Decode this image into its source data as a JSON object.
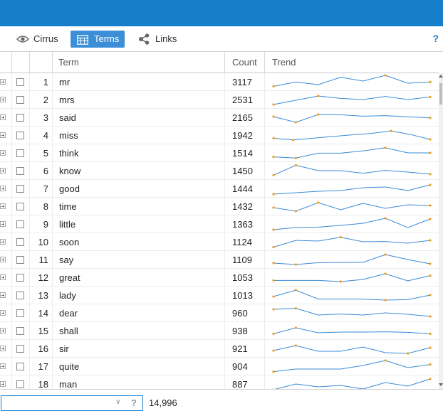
{
  "tabs": [
    {
      "label": "Cirrus",
      "icon": "eye-icon",
      "active": false
    },
    {
      "label": "Terms",
      "icon": "table-icon",
      "active": true
    },
    {
      "label": "Links",
      "icon": "share-icon",
      "active": false
    }
  ],
  "help_label": "?",
  "columns": {
    "term": "Term",
    "count": "Count",
    "trend": "Trend"
  },
  "rows": [
    {
      "num": "1",
      "term": "mr",
      "count": "3117",
      "trend": [
        0.18,
        0.48,
        0.3,
        0.82,
        0.55,
        0.95,
        0.4,
        0.48
      ]
    },
    {
      "num": "2",
      "term": "mrs",
      "count": "2531",
      "trend": [
        0.15,
        0.45,
        0.75,
        0.58,
        0.5,
        0.72,
        0.5,
        0.68
      ]
    },
    {
      "num": "3",
      "term": "said",
      "count": "2165",
      "trend": [
        0.55,
        0.15,
        0.7,
        0.68,
        0.58,
        0.62,
        0.54,
        0.47
      ]
    },
    {
      "num": "4",
      "term": "miss",
      "count": "1942",
      "trend": [
        0.28,
        0.16,
        0.28,
        0.4,
        0.52,
        0.62,
        0.8,
        0.54,
        0.2
      ]
    },
    {
      "num": "5",
      "term": "think",
      "count": "1514",
      "trend": [
        0.22,
        0.14,
        0.48,
        0.48,
        0.64,
        0.86,
        0.5,
        0.5
      ]
    },
    {
      "num": "6",
      "term": "know",
      "count": "1450",
      "trend": [
        0.18,
        0.88,
        0.5,
        0.5,
        0.32,
        0.52,
        0.4,
        0.26
      ]
    },
    {
      "num": "7",
      "term": "good",
      "count": "1444",
      "trend": [
        0.1,
        0.2,
        0.3,
        0.35,
        0.55,
        0.6,
        0.35,
        0.75
      ]
    },
    {
      "num": "8",
      "term": "time",
      "count": "1432",
      "trend": [
        0.4,
        0.15,
        0.75,
        0.25,
        0.7,
        0.35,
        0.6,
        0.55
      ]
    },
    {
      "num": "9",
      "term": "little",
      "count": "1363",
      "trend": [
        0.1,
        0.25,
        0.28,
        0.4,
        0.55,
        0.9,
        0.25,
        0.85
      ]
    },
    {
      "num": "10",
      "term": "soon",
      "count": "1124",
      "trend": [
        0.12,
        0.6,
        0.55,
        0.82,
        0.5,
        0.52,
        0.4,
        0.6
      ]
    },
    {
      "num": "11",
      "term": "say",
      "count": "1109",
      "trend": [
        0.25,
        0.15,
        0.28,
        0.3,
        0.3,
        0.85,
        0.5,
        0.2
      ]
    },
    {
      "num": "12",
      "term": "great",
      "count": "1053",
      "trend": [
        0.28,
        0.28,
        0.28,
        0.2,
        0.35,
        0.75,
        0.25,
        0.62
      ]
    },
    {
      "num": "13",
      "term": "lady",
      "count": "1013",
      "trend": [
        0.4,
        0.85,
        0.22,
        0.22,
        0.22,
        0.15,
        0.18,
        0.5
      ]
    },
    {
      "num": "14",
      "term": "dear",
      "count": "960",
      "trend": [
        0.75,
        0.82,
        0.35,
        0.42,
        0.35,
        0.5,
        0.4,
        0.25
      ]
    },
    {
      "num": "15",
      "term": "shall",
      "count": "938",
      "trend": [
        0.28,
        0.7,
        0.35,
        0.4,
        0.4,
        0.42,
        0.38,
        0.28
      ]
    },
    {
      "num": "16",
      "term": "sir",
      "count": "921",
      "trend": [
        0.35,
        0.7,
        0.3,
        0.3,
        0.6,
        0.2,
        0.15,
        0.55
      ]
    },
    {
      "num": "17",
      "term": "quite",
      "count": "904",
      "trend": [
        0.12,
        0.3,
        0.3,
        0.3,
        0.55,
        0.9,
        0.4,
        0.62
      ]
    },
    {
      "num": "18",
      "term": "man",
      "count": "887",
      "trend": [
        0.1,
        0.5,
        0.3,
        0.4,
        0.15,
        0.6,
        0.35,
        0.85
      ]
    }
  ],
  "search": {
    "value": "",
    "placeholder": ""
  },
  "total": "14,996",
  "colors": {
    "header": "#157fcc",
    "active_tab": "#3c8fd6",
    "sparkline": "#3a8ad6",
    "marker": "#f39c12"
  }
}
